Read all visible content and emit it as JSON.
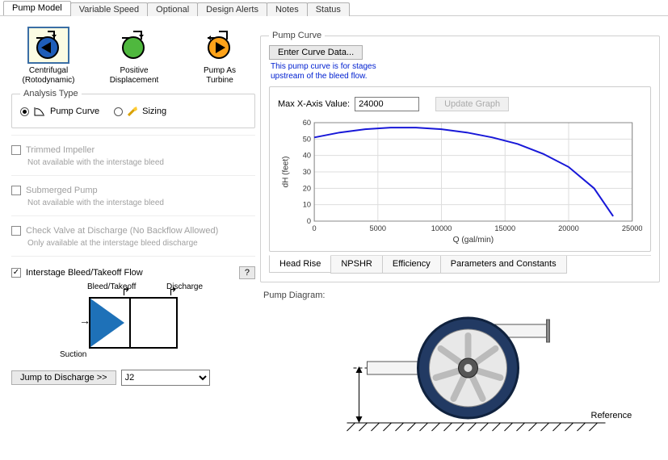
{
  "tabs": {
    "items": [
      {
        "label": "Pump Model"
      },
      {
        "label": "Variable Speed"
      },
      {
        "label": "Optional"
      },
      {
        "label": "Design Alerts"
      },
      {
        "label": "Notes"
      },
      {
        "label": "Status"
      }
    ],
    "active_index": 0
  },
  "pump_types": {
    "items": [
      {
        "label": "Centrifugal\n(Rotodynamic)",
        "color": "#1e5db8"
      },
      {
        "label": "Positive\nDisplacement",
        "color": "#4fb83e"
      },
      {
        "label": "Pump As\nTurbine",
        "color": "#ffa31a"
      }
    ],
    "selected_index": 0
  },
  "analysis": {
    "group_label": "Analysis Type",
    "pump_curve": "Pump Curve",
    "sizing": "Sizing",
    "selected": "pump_curve"
  },
  "options": {
    "trimmed_label": "Trimmed Impeller",
    "trimmed_hint": "Not available with the interstage bleed",
    "submerged_label": "Submerged Pump",
    "submerged_hint": "Not available with the interstage bleed",
    "checkvalve_label": "Check Valve at Discharge (No Backflow Allowed)",
    "checkvalve_hint": "Only available at the interstage bleed discharge"
  },
  "interstage": {
    "checkbox_label": "Interstage Bleed/Takeoff Flow",
    "checked": true,
    "help": "?",
    "bleed_label": "Bleed/Takeoff",
    "discharge_label": "Discharge",
    "suction_label": "Suction",
    "jump_button": "Jump to Discharge >>",
    "junction_value": "J2"
  },
  "pump_curve": {
    "group_label": "Pump Curve",
    "enter_button": "Enter Curve Data...",
    "note": "This pump curve is for stages\nupstream of the bleed flow.",
    "max_x_label": "Max X-Axis Value:",
    "max_x_value": "24000",
    "update_button": "Update Graph",
    "subtabs": [
      {
        "label": "Head Rise"
      },
      {
        "label": "NPSHR"
      },
      {
        "label": "Efficiency"
      },
      {
        "label": "Parameters and Constants"
      }
    ],
    "subtab_active": 0
  },
  "diagram": {
    "label": "Pump Diagram:",
    "reference": "Reference"
  },
  "chart_data": {
    "type": "line",
    "title": "",
    "xlabel": "Q (gal/min)",
    "ylabel": "dH (feet)",
    "xlim": [
      0,
      25000
    ],
    "ylim": [
      0,
      60
    ],
    "xticks": [
      0,
      5000,
      10000,
      15000,
      20000,
      25000
    ],
    "yticks": [
      0,
      10,
      20,
      30,
      40,
      50,
      60
    ],
    "series": [
      {
        "name": "Head Rise",
        "color": "#1818d8",
        "x": [
          0,
          2000,
          4000,
          6000,
          8000,
          10000,
          12000,
          14000,
          16000,
          18000,
          20000,
          22000,
          23500
        ],
        "y": [
          51,
          54,
          56,
          57,
          57,
          56,
          54,
          51,
          47,
          41,
          33,
          20,
          3
        ]
      }
    ]
  }
}
